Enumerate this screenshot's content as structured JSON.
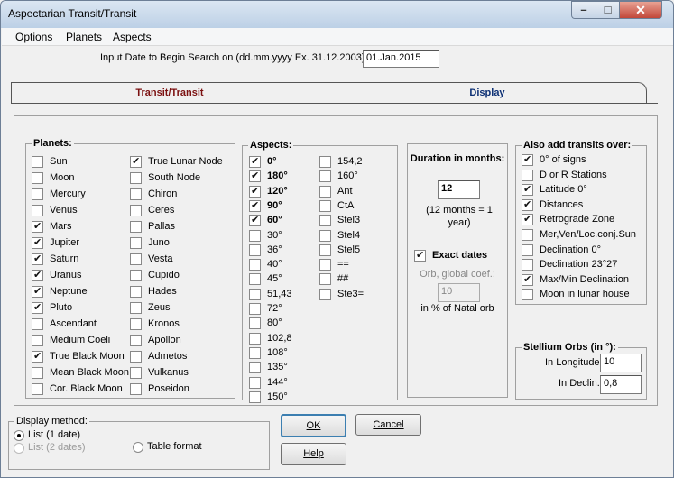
{
  "window": {
    "title": "Aspectarian Transit/Transit"
  },
  "menu": [
    "Options",
    "Planets",
    "Aspects"
  ],
  "search": {
    "label": "Input Date to Begin Search on (dd.mm.yyyy Ex. 31.12.2003):",
    "value": "01.Jan.2015"
  },
  "tabs": [
    {
      "label": "Transit/Transit",
      "active": true
    },
    {
      "label": "Display",
      "active": false
    }
  ],
  "planets": {
    "title": "Planets:",
    "col1": [
      {
        "label": "Sun",
        "checked": false
      },
      {
        "label": "Moon",
        "checked": false
      },
      {
        "label": "Mercury",
        "checked": false
      },
      {
        "label": "Venus",
        "checked": false
      },
      {
        "label": "Mars",
        "checked": true
      },
      {
        "label": "Jupiter",
        "checked": true
      },
      {
        "label": "Saturn",
        "checked": true
      },
      {
        "label": "Uranus",
        "checked": true
      },
      {
        "label": "Neptune",
        "checked": true
      },
      {
        "label": "Pluto",
        "checked": true
      },
      {
        "label": "Ascendant",
        "checked": false
      },
      {
        "label": "Medium Coeli",
        "checked": false
      },
      {
        "label": "True Black Moon",
        "checked": true
      },
      {
        "label": "Mean Black Moon",
        "checked": false
      },
      {
        "label": "Cor. Black Moon",
        "checked": false
      }
    ],
    "col2": [
      {
        "label": "True Lunar Node",
        "checked": true
      },
      {
        "label": "South Node",
        "checked": false
      },
      {
        "label": "Chiron",
        "checked": false
      },
      {
        "label": "Ceres",
        "checked": false
      },
      {
        "label": "Pallas",
        "checked": false
      },
      {
        "label": "Juno",
        "checked": false
      },
      {
        "label": "Vesta",
        "checked": false
      },
      {
        "label": "Cupido",
        "checked": false
      },
      {
        "label": "Hades",
        "checked": false
      },
      {
        "label": "Zeus",
        "checked": false
      },
      {
        "label": "Kronos",
        "checked": false
      },
      {
        "label": "Apollon",
        "checked": false
      },
      {
        "label": "Admetos",
        "checked": false
      },
      {
        "label": "Vulkanus",
        "checked": false
      },
      {
        "label": "Poseidon",
        "checked": false
      }
    ]
  },
  "aspects": {
    "title": "Aspects:",
    "col1": [
      {
        "label": "0°",
        "checked": true,
        "bold": true
      },
      {
        "label": "180°",
        "checked": true,
        "bold": true
      },
      {
        "label": "120°",
        "checked": true,
        "bold": true
      },
      {
        "label": "90°",
        "checked": true,
        "bold": true
      },
      {
        "label": "60°",
        "checked": true,
        "bold": true
      },
      {
        "label": "30°",
        "checked": false,
        "bold": false
      },
      {
        "label": "36°",
        "checked": false,
        "bold": false
      },
      {
        "label": "40°",
        "checked": false,
        "bold": false
      },
      {
        "label": "45°",
        "checked": false,
        "bold": false
      },
      {
        "label": "51,43",
        "checked": false,
        "bold": false
      },
      {
        "label": "72°",
        "checked": false,
        "bold": false
      },
      {
        "label": "80°",
        "checked": false,
        "bold": false
      },
      {
        "label": "102,8",
        "checked": false,
        "bold": false
      },
      {
        "label": "108°",
        "checked": false,
        "bold": false
      },
      {
        "label": "135°",
        "checked": false,
        "bold": false
      },
      {
        "label": "144°",
        "checked": false,
        "bold": false
      },
      {
        "label": "150°",
        "checked": false,
        "bold": false
      }
    ],
    "col2": [
      {
        "label": "154,2",
        "checked": false,
        "bold": false
      },
      {
        "label": "160°",
        "checked": false,
        "bold": false
      },
      {
        "label": "Ant",
        "checked": false,
        "bold": false
      },
      {
        "label": "CtA",
        "checked": false,
        "bold": false
      },
      {
        "label": "Stel3",
        "checked": false,
        "bold": false
      },
      {
        "label": "Stel4",
        "checked": false,
        "bold": false
      },
      {
        "label": "Stel5",
        "checked": false,
        "bold": false
      },
      {
        "label": "==",
        "checked": false,
        "bold": false
      },
      {
        "label": "##",
        "checked": false,
        "bold": false
      },
      {
        "label": "Ste3=",
        "checked": false,
        "bold": false
      }
    ]
  },
  "duration": {
    "title": "Duration in months:",
    "value": "12",
    "note": "(12 months = 1 year)",
    "exact_label": "Exact dates",
    "exact_checked": true,
    "orb_label": "Orb, global coef.:",
    "orb_value": "10",
    "orb_note": "in % of Natal orb"
  },
  "transits": {
    "title": "Also add transits over:",
    "items": [
      {
        "label": "0° of signs",
        "checked": true
      },
      {
        "label": "D or R Stations",
        "checked": false
      },
      {
        "label": "Latitude 0°",
        "checked": true
      },
      {
        "label": "Distances",
        "checked": true
      },
      {
        "label": "Retrograde Zone",
        "checked": true
      },
      {
        "label": "Mer,Ven/Loc.conj.Sun",
        "checked": false
      },
      {
        "label": "Declination 0°",
        "checked": false
      },
      {
        "label": "Declination 23°27",
        "checked": false
      },
      {
        "label": "Max/Min Declination",
        "checked": true
      },
      {
        "label": "Moon in lunar house",
        "checked": false
      }
    ]
  },
  "stellium": {
    "title": "Stellium Orbs (in °):",
    "longitude_label": "In Longitude",
    "longitude_value": "10",
    "declin_label": "In Declin.",
    "declin_value": "0,8"
  },
  "display_method": {
    "title": "Display method:",
    "options": [
      {
        "label": "List (1 date)",
        "selected": true,
        "enabled": true
      },
      {
        "label": "List (2 dates)",
        "selected": false,
        "enabled": false
      },
      {
        "label": "Table format",
        "selected": false,
        "enabled": true
      }
    ]
  },
  "buttons": {
    "ok": "OK",
    "cancel": "Cancel",
    "help": "Help"
  }
}
